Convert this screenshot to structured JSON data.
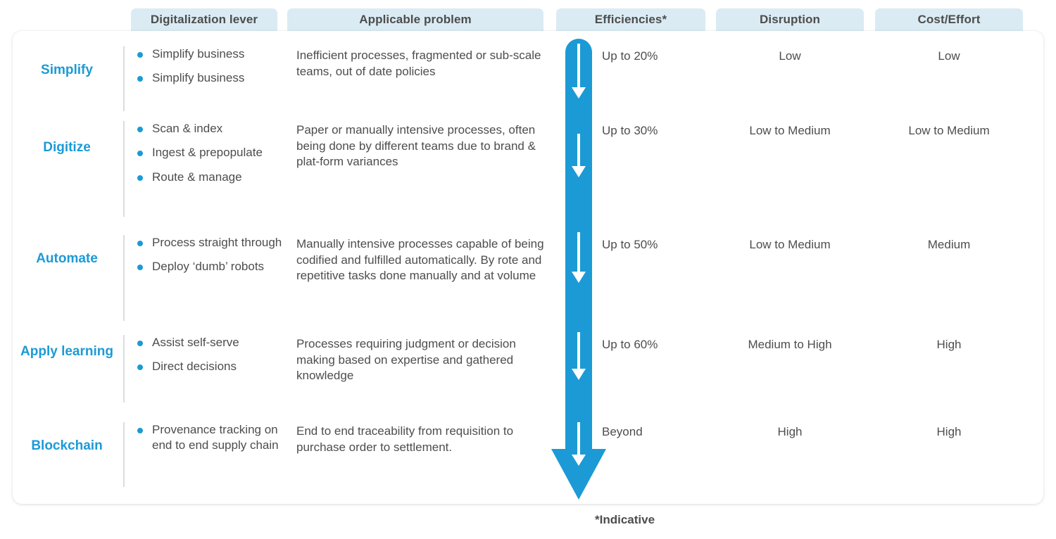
{
  "colors": {
    "accent_blue": "#1C9AD6",
    "chip_background": "#DAEBF3",
    "text_gray": "#4D4D4D",
    "divider_gray": "#DCDCDC",
    "card_background": "#FFFFFF"
  },
  "headers": {
    "lever": "Digitalization lever",
    "problem": "Applicable problem",
    "efficiency": "Efficiencies*",
    "disruption": "Disruption",
    "cost": "Cost/Effort"
  },
  "footnote": "*Indicative",
  "arrow": {
    "direction": "down",
    "segments": 5,
    "label": "increasing-efficiency-arrow"
  },
  "rows": [
    {
      "label": "Simplify",
      "levers": [
        "Simplify business",
        "Simplify business"
      ],
      "problem": "Inefficient processes, fragmented or sub-scale teams, out of date policies",
      "efficiency": "Up to 20%",
      "disruption": "Low",
      "cost": "Low"
    },
    {
      "label": "Digitize",
      "levers": [
        "Scan & index",
        "Ingest & prepopulate",
        "Route & manage"
      ],
      "problem": "Paper or manually intensive processes, often being done by different teams due to brand & plat-form variances",
      "efficiency": "Up to 30%",
      "disruption": "Low to Medium",
      "cost": "Low to Medium"
    },
    {
      "label": "Automate",
      "levers": [
        "Process straight through",
        "Deploy ‘dumb’ robots"
      ],
      "problem": "Manually intensive processes capable of being codified and fulfilled automatically. By rote and repetitive tasks done manually and at volume",
      "efficiency": "Up to 50%",
      "disruption": "Low to Medium",
      "cost": "Medium"
    },
    {
      "label": "Apply learning",
      "levers": [
        "Assist self-serve",
        "Direct decisions"
      ],
      "problem": "Processes requiring judgment or decision making based on expertise and gathered knowledge",
      "efficiency": "Up to 60%",
      "disruption": "Medium to High",
      "cost": "High"
    },
    {
      "label": "Blockchain",
      "levers": [
        "Provenance tracking on end to end supply chain"
      ],
      "problem": "End to end traceability from requisition to purchase order to settlement.",
      "efficiency": "Beyond",
      "disruption": "High",
      "cost": "High"
    }
  ]
}
